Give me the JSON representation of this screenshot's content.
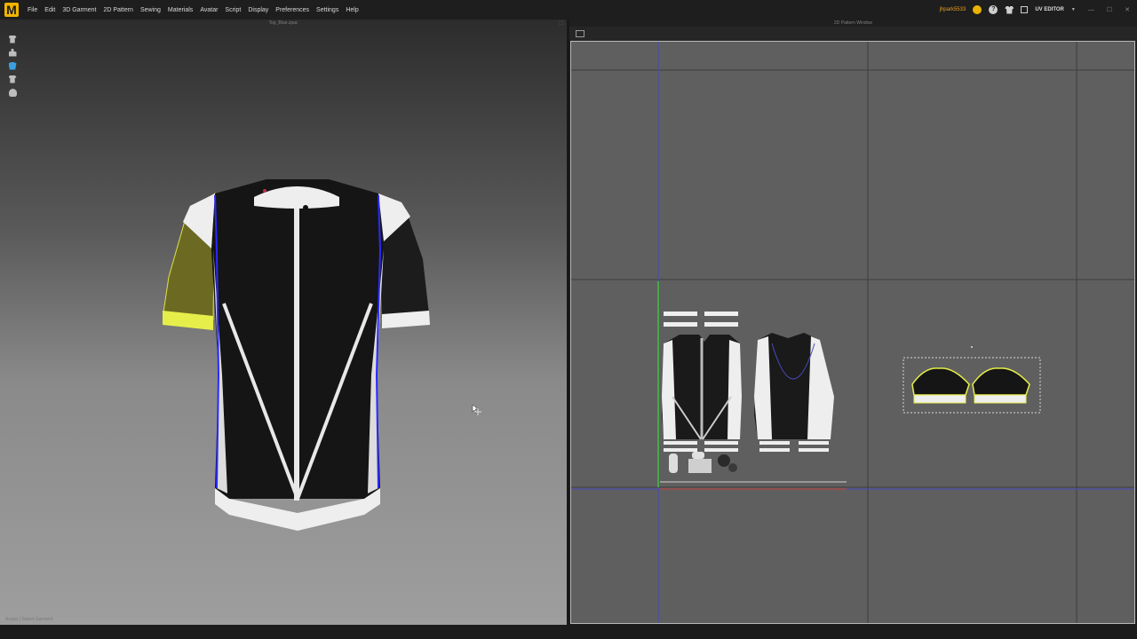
{
  "app": {
    "logo": "M",
    "menu": [
      "File",
      "Edit",
      "3D Garment",
      "2D Pattern",
      "Sewing",
      "Materials",
      "Avatar",
      "Script",
      "Display",
      "Preferences",
      "Settings",
      "Help"
    ]
  },
  "user": {
    "name": "jhpark5533",
    "mode_label": "UV EDITOR"
  },
  "panes": {
    "left_title": "Top_Blue.zpac",
    "right_title": "2D Pattern Window"
  },
  "status": {
    "text": "Avatar | Select Garment"
  },
  "icons": {
    "left_toolbar": [
      "garment-tool-icon",
      "avatar-tool-icon",
      "texture-tool-icon",
      "fitting-tool-icon",
      "head-tool-icon"
    ],
    "header": [
      "coin-icon",
      "help-icon",
      "shirt-icon",
      "uv-grid-icon",
      "dropdown-icon"
    ]
  },
  "colors": {
    "accent": "#f0b400",
    "selection_yellow": "#e6ee4a",
    "garment_black": "#151515",
    "trim_white": "#eeeeee",
    "seam_blue": "#2a2aff",
    "canvas_gray": "#5f5f5f"
  }
}
